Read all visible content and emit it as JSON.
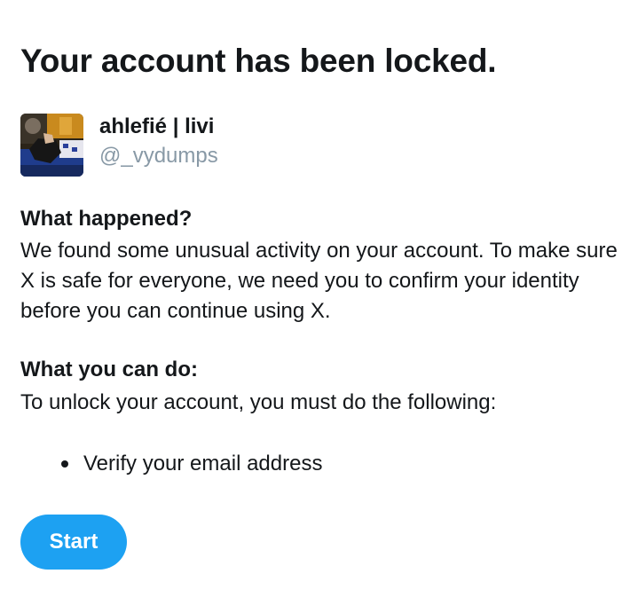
{
  "page": {
    "title": "Your account has been locked."
  },
  "profile": {
    "display_name": "ahlefié | livi",
    "handle": "@_vydumps",
    "avatar_icon": "profile-photo"
  },
  "what_happened": {
    "heading": "What happened?",
    "text": "We found some unusual activity on your account. To make sure X is safe for everyone, we need you to confirm your identity before you can continue using X."
  },
  "what_you_can_do": {
    "heading": "What you can do:",
    "text": "To unlock your account, you must do the following:",
    "steps": [
      "Verify your email address"
    ]
  },
  "actions": {
    "start_label": "Start"
  },
  "colors": {
    "accent": "#1da1f2",
    "text_primary": "#14171a",
    "text_secondary": "#8899a6",
    "background": "#ffffff"
  }
}
